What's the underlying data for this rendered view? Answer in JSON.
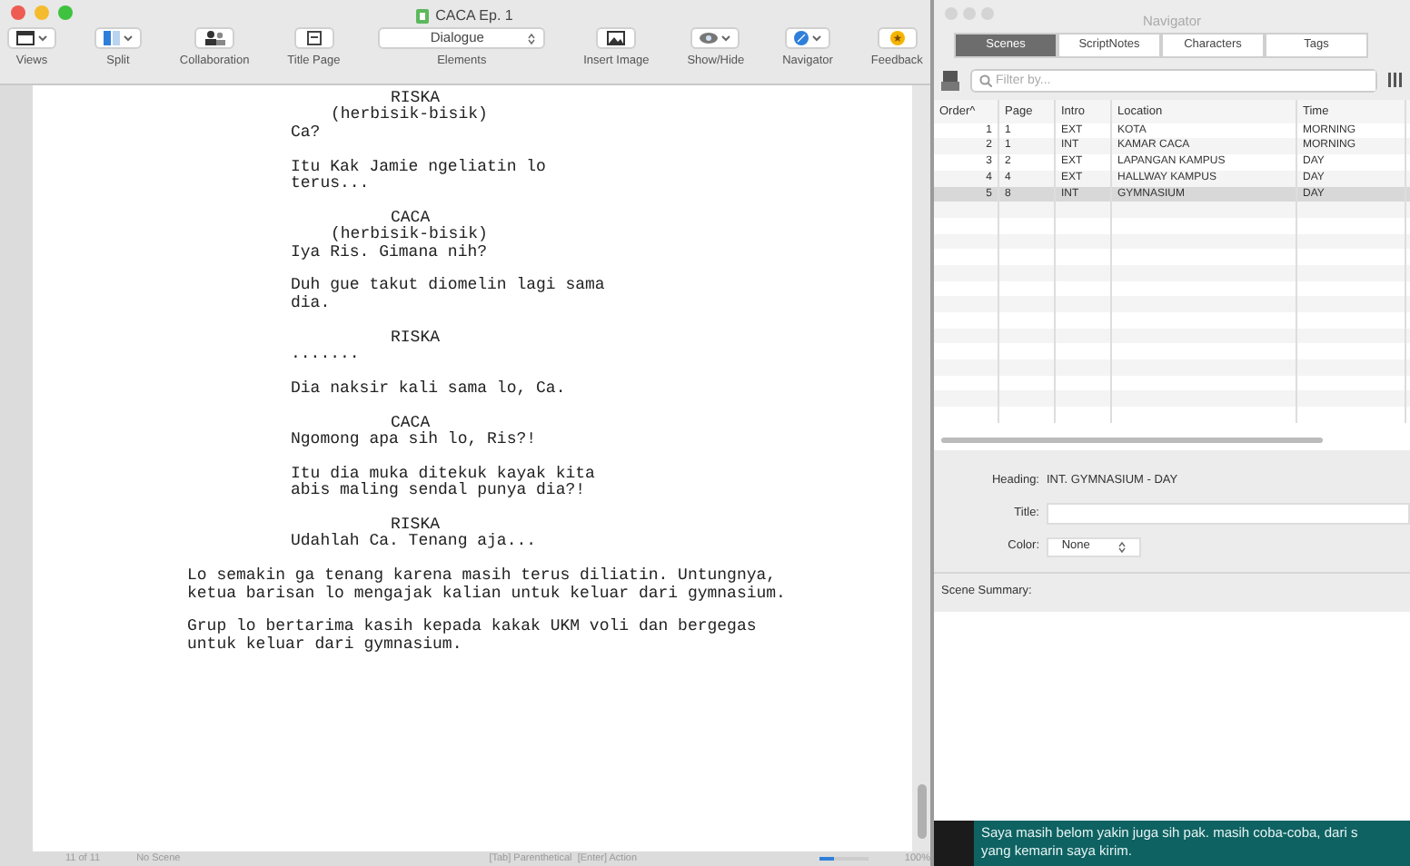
{
  "window": {
    "title": "CACA Ep. 1"
  },
  "toolbar": [
    {
      "label": "Views",
      "kind": "button"
    },
    {
      "label": "Split",
      "kind": "button"
    },
    {
      "label": "Collaboration",
      "kind": "button"
    },
    {
      "label": "Title Page",
      "kind": "button"
    },
    {
      "label": "Elements",
      "kind": "popup",
      "value": "Dialogue"
    },
    {
      "label": "Insert Image",
      "kind": "button"
    },
    {
      "label": "Show/Hide",
      "kind": "button"
    },
    {
      "label": "Navigator",
      "kind": "button"
    },
    {
      "label": "Feedback",
      "kind": "button"
    }
  ],
  "script": [
    {
      "kind": "character",
      "text": "RISKA"
    },
    {
      "kind": "parenthetical",
      "text": "(herbisik-bisik)"
    },
    {
      "kind": "dialogue",
      "text": "Ca?"
    },
    {
      "kind": "dialogue",
      "text": "Itu Kak Jamie ngeliatin lo terus..."
    },
    {
      "kind": "character",
      "text": "CACA"
    },
    {
      "kind": "parenthetical",
      "text": "(herbisik-bisik)"
    },
    {
      "kind": "dialogue",
      "text": "Iya Ris. Gimana nih?"
    },
    {
      "kind": "dialogue",
      "text": "Duh gue takut diomelin lagi sama dia."
    },
    {
      "kind": "character",
      "text": "RISKA"
    },
    {
      "kind": "dialogue",
      "text": "......."
    },
    {
      "kind": "dialogue",
      "text": "Dia naksir kali sama lo, Ca."
    },
    {
      "kind": "character",
      "text": "CACA"
    },
    {
      "kind": "dialogue",
      "text": "Ngomong apa sih lo, Ris?!"
    },
    {
      "kind": "dialogue",
      "text": "Itu dia muka ditekuk kayak kita abis maling sendal punya dia?!"
    },
    {
      "kind": "character",
      "text": "RISKA"
    },
    {
      "kind": "dialogue",
      "text": "Udahlah Ca. Tenang aja..."
    },
    {
      "kind": "action",
      "text": "Lo semakin ga tenang karena masih terus diliatin. Untungnya, ketua barisan lo mengajak kalian untuk keluar dari gymnasium."
    },
    {
      "kind": "action",
      "text": "Grup lo bertarima kasih kepada kakak UKM voli dan bergegas untuk keluar dari gymnasium."
    }
  ],
  "status_bar": {
    "page": "11 of 11",
    "scene": "No Scene",
    "hint": "[Tab] Parenthetical  [Enter] Action",
    "zoom": "100%",
    "level": 0.3
  },
  "navigator": {
    "title": "Navigator",
    "tabs": [
      {
        "label": "Scenes",
        "selected": true
      },
      {
        "label": "ScriptNotes",
        "selected": false
      },
      {
        "label": "Characters",
        "selected": false
      },
      {
        "label": "Tags",
        "selected": false
      }
    ],
    "filter": {
      "placeholder": "Filter by..."
    },
    "columns": [
      "Order^",
      "Page",
      "Intro",
      "Location",
      "Time"
    ],
    "rows": [
      {
        "cells": [
          "1",
          "1",
          "EXT",
          "KOTA",
          "MORNING"
        ],
        "selected": false
      },
      {
        "cells": [
          "2",
          "1",
          "INT",
          "KAMAR CACA",
          "MORNING"
        ],
        "selected": false
      },
      {
        "cells": [
          "3",
          "2",
          "EXT",
          "LAPANGAN KAMPUS",
          "DAY"
        ],
        "selected": false
      },
      {
        "cells": [
          "4",
          "4",
          "EXT",
          "HALLWAY KAMPUS",
          "DAY"
        ],
        "selected": false
      },
      {
        "cells": [
          "5",
          "8",
          "INT",
          "GYMNASIUM",
          "DAY"
        ],
        "selected": true
      }
    ],
    "heading_label": "Heading:",
    "heading": "INT. GYMNASIUM - DAY",
    "title_label": "Title:",
    "color_label": "Color:",
    "color_value": "None",
    "summary_label": "Scene Summary:"
  },
  "caption": "Saya masih belom yakin juga sih pak. masih coba-coba, dari s\nyang kemarin saya kirim."
}
